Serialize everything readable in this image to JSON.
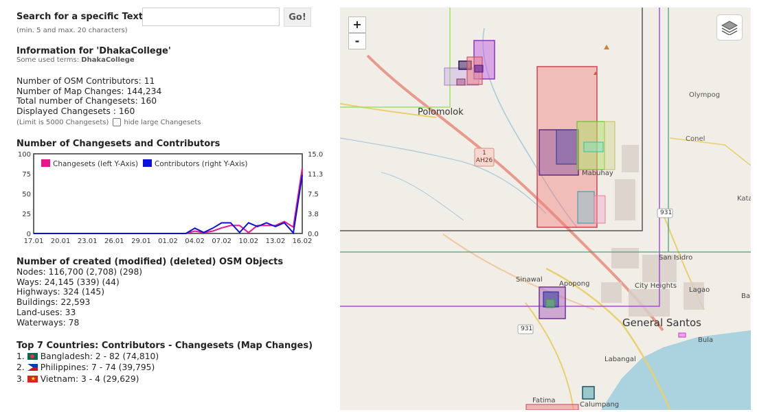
{
  "search": {
    "label": "Search for a specific Text:",
    "value": "",
    "placeholder": "",
    "button": "Go!",
    "hint": "(min. 5 and max. 20 characters)"
  },
  "info": {
    "title": "Information for 'DhakaCollege'",
    "used_terms_prefix": "Some used terms: ",
    "used_terms": "DhakaCollege"
  },
  "stats": [
    "Number of OSM Contributors: 11",
    "Number of Map Changes: 144,234",
    "Total number of Changesets: 160",
    "Displayed Changesets : 160"
  ],
  "limit_note": "(Limit is 5000 Changesets)",
  "hide_large_label": "hide large Changesets",
  "chart_title": "Number of Changesets and Contributors",
  "chart_data": {
    "type": "line",
    "categories": [
      "17.01",
      "20.01",
      "23.01",
      "26.01",
      "29.01",
      "01.02",
      "04.02",
      "07.02",
      "10.02",
      "13.02",
      "16.02"
    ],
    "x_index": [
      0,
      1,
      2,
      3,
      4,
      5,
      6,
      7,
      8,
      9,
      10,
      11,
      12,
      13,
      14,
      15,
      16,
      17,
      18,
      19,
      20,
      21,
      22,
      23,
      24,
      25,
      26,
      27,
      28,
      29,
      30
    ],
    "series": [
      {
        "name": "Changesets (left Y-Axis)",
        "color": "#e8168a",
        "axis": "left",
        "values": [
          0,
          0,
          0,
          0,
          0,
          0,
          0,
          0,
          0,
          0,
          0,
          0,
          0,
          0,
          0,
          0,
          0,
          0,
          3,
          1,
          3,
          7,
          10,
          10,
          1,
          10,
          10,
          10,
          15,
          8,
          82
        ]
      },
      {
        "name": "Contributors (right Y-Axis)",
        "color": "#0a10e0",
        "axis": "right",
        "values": [
          0,
          0,
          0,
          0,
          0,
          0,
          0,
          0,
          0,
          0,
          0,
          0,
          0,
          0,
          0,
          0,
          0,
          0,
          1,
          0.2,
          1,
          2,
          2,
          0.2,
          2,
          1.3,
          2,
          1.3,
          2,
          0.1,
          11
        ]
      }
    ],
    "y_left_ticks": [
      "100",
      "75",
      "50",
      "25",
      "0"
    ],
    "y_right_ticks": [
      "15.0",
      "11.3",
      "7.5",
      "3.8",
      "0.0"
    ],
    "ylim_left": [
      0,
      100
    ],
    "ylim_right": [
      0,
      15
    ],
    "legend_position": "top-left"
  },
  "objects_title": "Number of created (modified) (deleted) OSM Objects",
  "objects": [
    "Nodes: 116,700 (2,708) (298)",
    "Ways: 24,145 (339) (44)",
    "Highways: 324 (145)",
    "Buildings: 22,593",
    "Land-uses: 33",
    "Waterways: 78"
  ],
  "countries_title": "Top 7 Countries: Contributors - Changesets (Map Changes)",
  "countries": [
    {
      "rank": "1.",
      "flag": "bangladesh-flag-icon",
      "text": "Bangladesh: 2 - 82 (74,810)"
    },
    {
      "rank": "2.",
      "flag": "philippines-flag-icon",
      "text": "Philippines: 7 - 74 (39,795)"
    },
    {
      "rank": "3.",
      "flag": "vietnam-flag-icon",
      "text": "Vietnam: 3 - 4 (29,629)"
    }
  ],
  "map": {
    "zoom_in": "+",
    "zoom_out": "-",
    "labels": [
      "Polomolok",
      "Olympog",
      "Conel",
      "Mabuhay",
      "Kata",
      "931",
      "San Isidro",
      "Sinawal",
      "Apopong",
      "City Heights",
      "Lagao",
      "Bal",
      "General Santos",
      "Bula",
      "931",
      "Labangal",
      "Fatima",
      "Calumpang"
    ],
    "road_shield_top": "1",
    "road_shield_bottom": "AH26"
  }
}
